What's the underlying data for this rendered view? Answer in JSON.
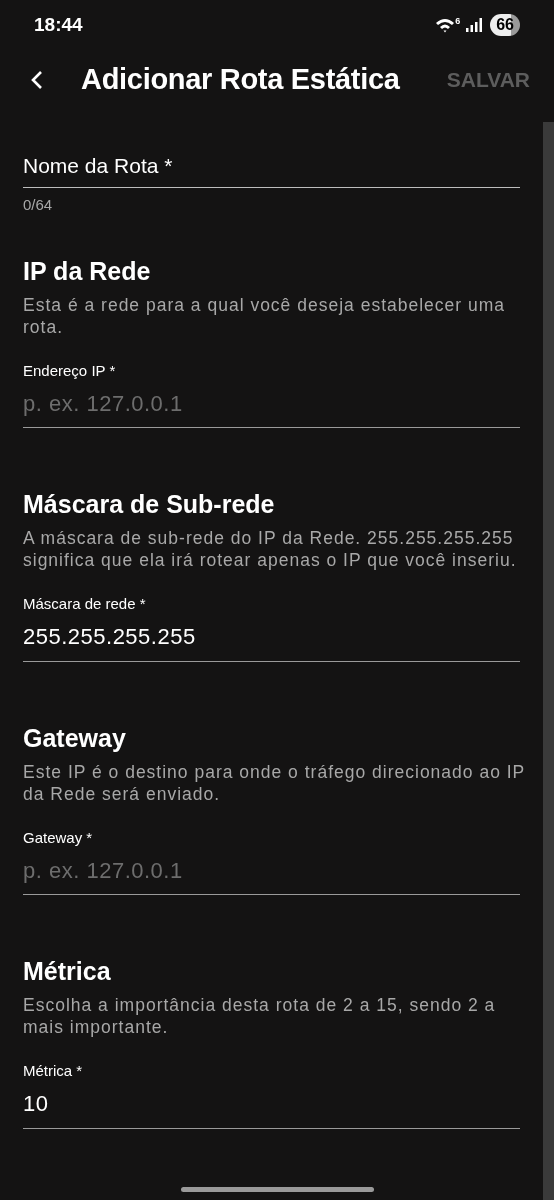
{
  "status_bar": {
    "time": "18:44",
    "wifi_badge": "6",
    "battery": "66"
  },
  "app_bar": {
    "title": "Adicionar Rota Estática",
    "action": {
      "label": "SALVAR",
      "disabled": true
    }
  },
  "name_field": {
    "label": "Nome da Rota *",
    "counter": "0/64"
  },
  "sections": [
    {
      "title": "IP da Rede",
      "description": "Esta é a rede para a qual você deseja estabelecer uma rota.",
      "field": {
        "label": "Endereço IP *",
        "placeholder": "p. ex. 127.0.0.1"
      }
    },
    {
      "title": "Máscara de Sub-rede",
      "description": "A máscara de sub-rede do IP da Rede. 255.255.255.255 significa que ela irá rotear apenas o IP que você inseriu.",
      "field": {
        "label": "Máscara de rede *",
        "value": "255.255.255.255"
      }
    },
    {
      "title": "Gateway",
      "description": "Este IP é o destino para onde o tráfego direcionado ao IP da Rede será enviado.",
      "field": {
        "label": "Gateway *",
        "placeholder": "p. ex. 127.0.0.1"
      }
    },
    {
      "title": "Métrica",
      "description": "Escolha a importância desta rota de 2 a 15, sendo 2 a mais importante.",
      "field": {
        "label": "Métrica *",
        "value": "10"
      }
    }
  ]
}
